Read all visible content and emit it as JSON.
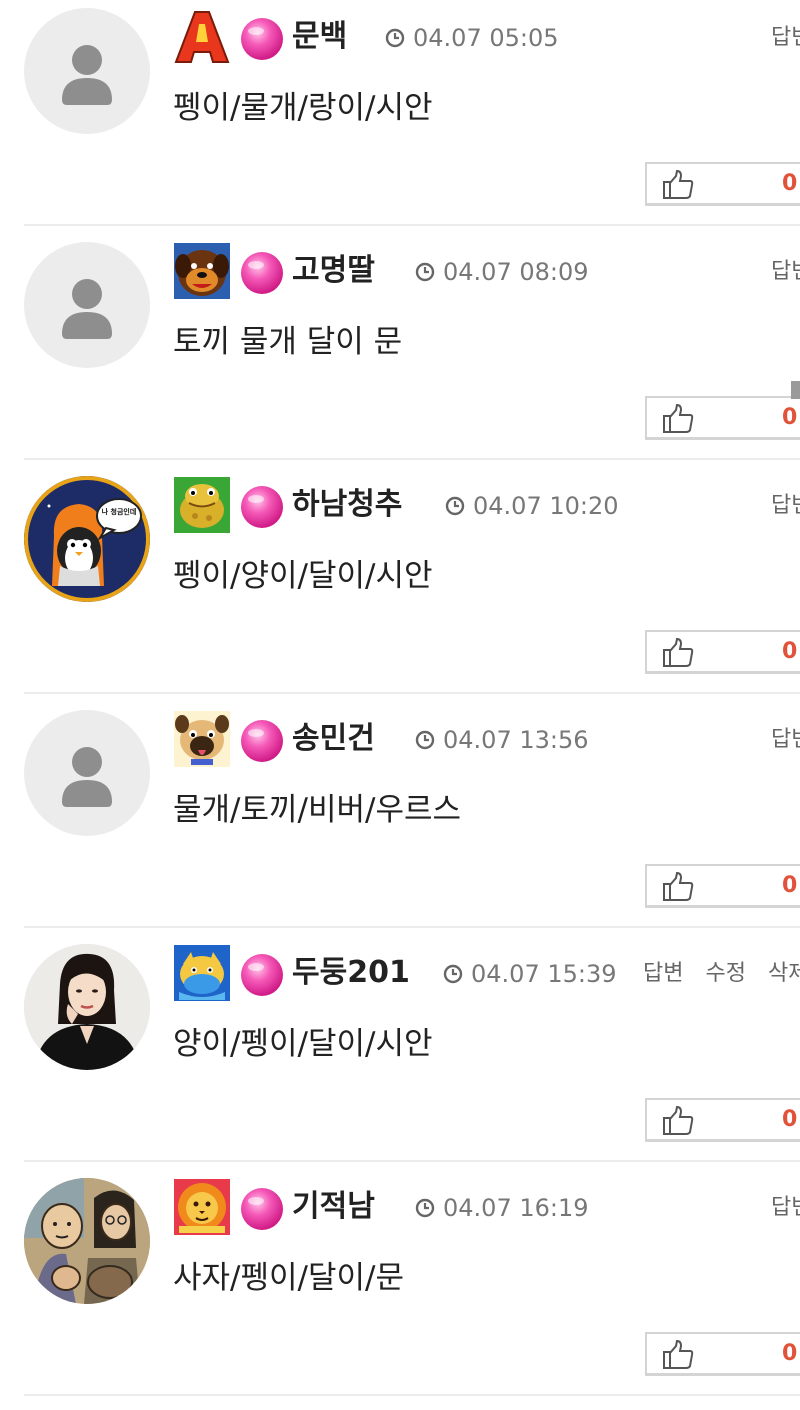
{
  "comments": [
    {
      "nickname": "문백",
      "time": "04.07 05:05",
      "text": "펭이/물개/랑이/시안",
      "actions": [
        "답변"
      ],
      "likes": "0",
      "avatar": "default-person",
      "level_icon": "letter-a-icon",
      "level_icon_letter": "A"
    },
    {
      "nickname": "고명딸",
      "time": "04.07 08:09",
      "text": "토끼 물개 달이 문",
      "actions": [
        "답변"
      ],
      "likes": "0",
      "avatar": "default-person",
      "level_icon": "dog-icon"
    },
    {
      "nickname": "하남청추",
      "time": "04.07 10:20",
      "text": "펭이/양이/달이/시안",
      "actions": [
        "답변"
      ],
      "likes": "0",
      "avatar": "penguin-photo",
      "avatar_bubble": "나 청금인데",
      "level_icon": "frog-icon"
    },
    {
      "nickname": "송민건",
      "time": "04.07 13:56",
      "text": "물개/토끼/비버/우르스",
      "actions": [
        "답변"
      ],
      "likes": "0",
      "avatar": "default-person",
      "level_icon": "pug-icon"
    },
    {
      "nickname": "두둥201",
      "time": "04.07 15:39",
      "text": "양이/펭이/달이/시안",
      "actions": [
        "답변",
        "수정",
        "삭제"
      ],
      "likes": "0",
      "avatar": "woman-photo",
      "level_icon": "dragon-icon"
    },
    {
      "nickname": "기적남",
      "time": "04.07 16:19",
      "text": "사자/펭이/달이/문",
      "actions": [
        "답변"
      ],
      "likes": "0",
      "avatar": "painting-photo",
      "level_icon": "lion-icon"
    }
  ],
  "colors": {
    "like_count": "#e0533a",
    "candy": "#f040a8",
    "divider": "#ececec",
    "default_avatar_bg": "#ececec"
  }
}
